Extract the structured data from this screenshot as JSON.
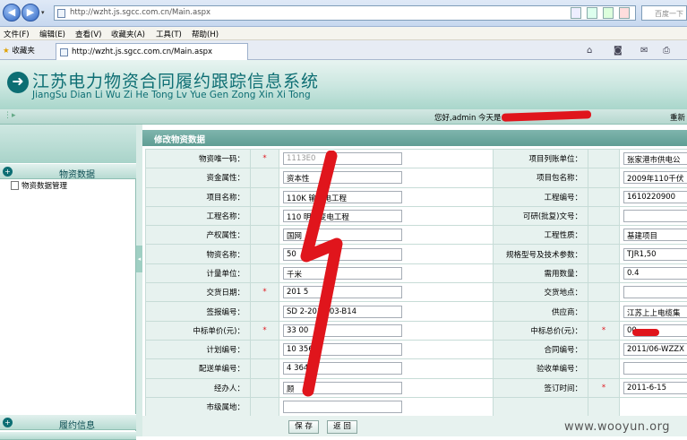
{
  "browser": {
    "url": "http://wzht.js.sgcc.com.cn/Main.aspx",
    "search_placeholder": "百度一下",
    "menu": [
      "文件(F)",
      "编辑(E)",
      "查看(V)",
      "收藏夹(A)",
      "工具(T)",
      "帮助(H)"
    ],
    "favorites_label": "收藏夹",
    "tab_title": "http://wzht.js.sgcc.com.cn/Main.aspx"
  },
  "header": {
    "title_cn": "江苏电力物资合同履约跟踪信息系统",
    "title_en": "JiangSu Dian Li Wu Zi He Tong Lv Yue Gen Zong Xin Xi Tong",
    "greeting": "您好,admin 今天是",
    "relogin": "重新"
  },
  "sidebar": {
    "sections": [
      {
        "label": "物资数据"
      },
      {
        "label": "履约信息"
      }
    ],
    "items": [
      {
        "label": "物资数据管理"
      }
    ]
  },
  "form": {
    "title": "修改物资数据",
    "rows": [
      {
        "l_label": "物资唯一码：",
        "l_req": "*",
        "l_value": "1113E0",
        "l_gray": true,
        "r_label": "项目列账单位：",
        "r_req": "",
        "r_value": "张家港市供电公"
      },
      {
        "l_label": "资金属性：",
        "l_req": "",
        "l_value": "资本性",
        "r_label": "项目包名称：",
        "r_req": "",
        "r_value": "2009年110千伏"
      },
      {
        "l_label": "项目名称：",
        "l_req": "",
        "l_value": "110K   输变电工程",
        "r_label": "工程编号：",
        "r_req": "",
        "r_value": "1610220900"
      },
      {
        "l_label": "工程名称：",
        "l_req": "",
        "l_value": "110   明输变电工程",
        "r_label": "可研(批复)文号：",
        "r_req": "",
        "r_value": ""
      },
      {
        "l_label": "产权属性：",
        "l_req": "",
        "l_value": "国网",
        "r_label": "工程性质：",
        "r_req": "",
        "r_value": "基建项目"
      },
      {
        "l_label": "物资名称：",
        "l_req": "",
        "l_value": "50",
        "r_label": "规格型号及技术参数：",
        "r_req": "",
        "r_value": "TJR1,50"
      },
      {
        "l_label": "计量单位：",
        "l_req": "",
        "l_value": "千米",
        "r_label": "需用数量：",
        "r_req": "",
        "r_value": "0.4"
      },
      {
        "l_label": "交货日期：",
        "l_req": "*",
        "l_value": "201    5",
        "r_label": "交货地点：",
        "r_req": "",
        "r_value": ""
      },
      {
        "l_label": "签报编号：",
        "l_req": "",
        "l_value": "SD    2-2011-03-B14",
        "r_label": "供应商：",
        "r_req": "",
        "r_value": "江苏上上电缆集"
      },
      {
        "l_label": "中标单价(元)：",
        "l_req": "*",
        "l_value": "33     00",
        "r_label": "中标总价(元)：",
        "r_req": "*",
        "r_value": "       00"
      },
      {
        "l_label": "计划编号：",
        "l_req": "",
        "l_value": "10     356",
        "r_label": "合同编号：",
        "r_req": "",
        "r_value": "2011/06-WZZX"
      },
      {
        "l_label": "配送单编号：",
        "l_req": "",
        "l_value": "4     36462",
        "r_label": "验收单编号：",
        "r_req": "",
        "r_value": ""
      },
      {
        "l_label": "经办人：",
        "l_req": "",
        "l_value": "顾",
        "r_label": "签订时间：",
        "r_req": "*",
        "r_value": "2011-6-15"
      },
      {
        "l_label": "市级属地：",
        "l_req": "",
        "l_value": "",
        "r_label": "",
        "r_req": "",
        "r_value": ""
      }
    ],
    "save_label": "保 存",
    "back_label": "返 回"
  },
  "watermark": "www.wooyun.org",
  "colors": {
    "accent": "#0d6e73",
    "redaction": "#e0151c"
  }
}
